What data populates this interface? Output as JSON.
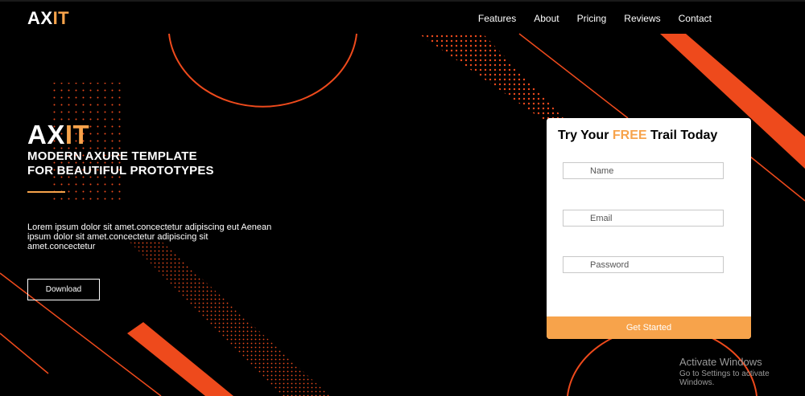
{
  "header": {
    "logo_ax": "AX",
    "logo_it": "IT",
    "nav": [
      "Features",
      "About",
      "Pricing",
      "Reviews",
      "Contact"
    ]
  },
  "hero": {
    "logo_ax": "AX",
    "logo_it": "IT",
    "tagline_line1": "MODERN AXURE TEMPLATE",
    "tagline_line2": "FOR BEAUTIFUL PROTOTYPES",
    "description": "Lorem ipsum dolor sit amet.concectetur adipiscing eut Aenean ipsum dolor sit amet.concectetur adipiscing sit amet.concectetur",
    "download_label": "Download"
  },
  "form": {
    "title_pre": "Try Your ",
    "title_free": "FREE",
    "title_post": " Trail Today",
    "name_placeholder": "Name",
    "email_placeholder": "Email",
    "password_placeholder": "Password",
    "submit_label": "Get Started"
  },
  "watermark": {
    "title": "Activate Windows",
    "subtitle": "Go to Settings to activate Windows."
  },
  "colors": {
    "accent": "#f7a34b",
    "shape": "#ee4a1c",
    "background": "#000000"
  }
}
